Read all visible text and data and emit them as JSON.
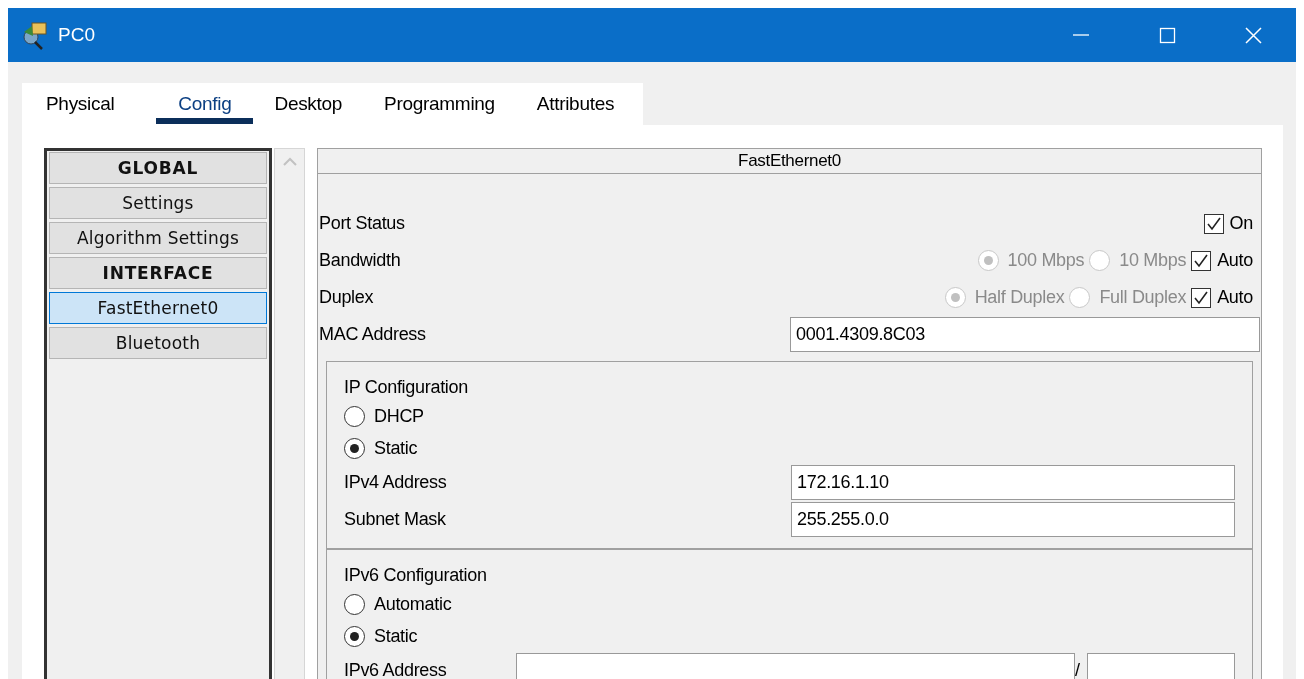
{
  "window": {
    "title": "PC0"
  },
  "tabs": [
    {
      "label": "Physical",
      "selected": false
    },
    {
      "label": "Config",
      "selected": true
    },
    {
      "label": "Desktop",
      "selected": false
    },
    {
      "label": "Programming",
      "selected": false
    },
    {
      "label": "Attributes",
      "selected": false
    }
  ],
  "sidebar": {
    "items": [
      {
        "label": "GLOBAL",
        "kind": "header",
        "selected": false
      },
      {
        "label": "Settings",
        "kind": "item",
        "selected": false
      },
      {
        "label": "Algorithm Settings",
        "kind": "item",
        "selected": false
      },
      {
        "label": "INTERFACE",
        "kind": "header",
        "selected": false
      },
      {
        "label": "FastEthernet0",
        "kind": "item",
        "selected": true
      },
      {
        "label": "Bluetooth",
        "kind": "item",
        "selected": false
      }
    ]
  },
  "interface": {
    "title": "FastEthernet0",
    "rows": [
      {
        "label": "Port Status",
        "checkboxes": [
          {
            "label": "On",
            "checked": true
          }
        ]
      },
      {
        "label": "Bandwidth",
        "radios": [
          {
            "label": "100 Mbps",
            "selected": true,
            "disabled": true
          },
          {
            "label": "10 Mbps",
            "selected": false,
            "disabled": true
          }
        ],
        "checkboxes": [
          {
            "label": "Auto",
            "checked": true
          }
        ]
      },
      {
        "label": "Duplex",
        "radios": [
          {
            "label": "Half Duplex",
            "selected": true,
            "disabled": true
          },
          {
            "label": "Full Duplex",
            "selected": false,
            "disabled": true
          }
        ],
        "checkboxes": [
          {
            "label": "Auto",
            "checked": true
          }
        ]
      },
      {
        "label": "MAC Address",
        "value": "0001.4309.8C03"
      }
    ],
    "ip_configuration": {
      "title": "IP Configuration",
      "modes": [
        {
          "label": "DHCP",
          "selected": false
        },
        {
          "label": "Static",
          "selected": true
        }
      ],
      "fields": [
        {
          "label": "IPv4 Address",
          "value": "172.16.1.10"
        },
        {
          "label": "Subnet Mask",
          "value": "255.255.0.0"
        }
      ]
    },
    "ipv6_configuration": {
      "title": "IPv6 Configuration",
      "modes": [
        {
          "label": "Automatic",
          "selected": false
        },
        {
          "label": "Static",
          "selected": true
        }
      ],
      "fields": [
        {
          "label": "IPv6 Address",
          "separator": "/"
        }
      ]
    }
  }
}
